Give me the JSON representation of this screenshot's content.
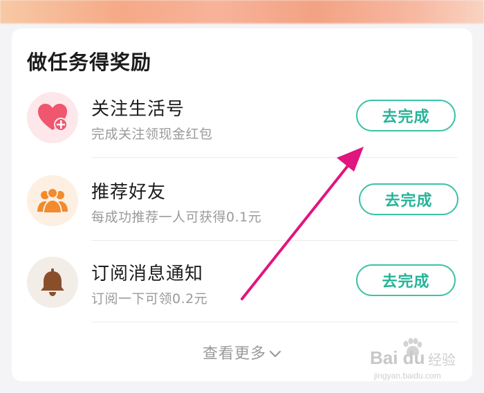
{
  "card": {
    "title": "做任务得奖励"
  },
  "tasks": [
    {
      "name": "关注生活号",
      "desc": "完成关注领现金红包",
      "button": "去完成",
      "icon": "heart-plus-icon",
      "icon_bg": "#fde7ea",
      "icon_color": "#f0566e"
    },
    {
      "name": "推荐好友",
      "desc": "每成功推荐一人可获得0.1元",
      "button": "去完成",
      "icon": "users-icon",
      "icon_bg": "#fdf0e3",
      "icon_color": "#f28a2e"
    },
    {
      "name": "订阅消息通知",
      "desc": "订阅一下可领0.2元",
      "button": "去完成",
      "icon": "bell-icon",
      "icon_bg": "#f3ede8",
      "icon_color": "#8a4f2a"
    }
  ],
  "more": {
    "label": "查看更多"
  },
  "watermark": {
    "brand": "Bai du",
    "product": "经验",
    "url": "jingyan.baidu.com"
  },
  "colors": {
    "accent": "#3cc2a6",
    "annotation_arrow": "#e0157e"
  }
}
